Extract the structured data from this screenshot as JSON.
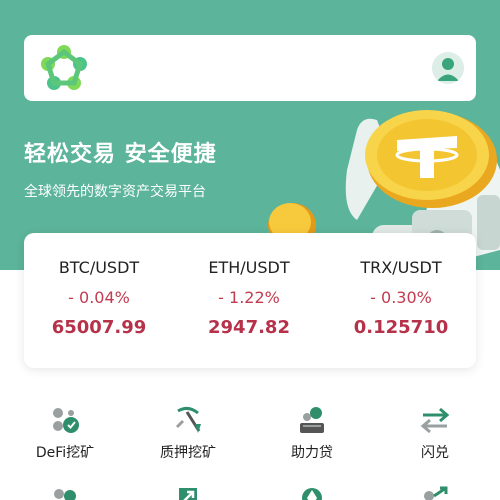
{
  "hero": {
    "title": "轻松交易 安全便捷",
    "subtitle": "全球领先的数字资产交易平台"
  },
  "icons": {
    "logo": "brand-logo",
    "avatar": "user-avatar-icon",
    "hero_art": "coin-robot-illustration"
  },
  "colors": {
    "brand_green": "#5cb49a",
    "down_red": "#c23b50"
  },
  "tickers": [
    {
      "pair": "BTC/USDT",
      "change": "- 0.04%",
      "price": "65007.99"
    },
    {
      "pair": "ETH/USDT",
      "change": "- 1.22%",
      "price": "2947.82"
    },
    {
      "pair": "TRX/USDT",
      "change": "- 0.30%",
      "price": "0.125710"
    }
  ],
  "menu": [
    {
      "label": "DeFi挖矿",
      "icon": "defi-mining-icon"
    },
    {
      "label": "质押挖矿",
      "icon": "pickaxe-icon"
    },
    {
      "label": "助力贷",
      "icon": "loan-icon"
    },
    {
      "label": "闪兑",
      "icon": "swap-icon"
    }
  ],
  "menu_row2_icons": [
    "group-icon",
    "trend-up-icon",
    "drop-icon",
    "share-icon"
  ]
}
